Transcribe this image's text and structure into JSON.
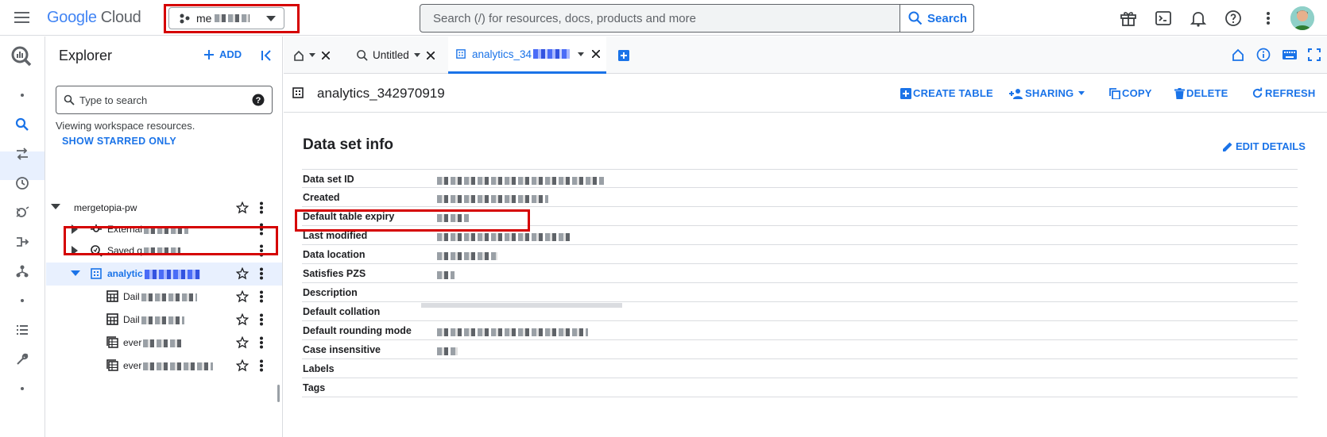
{
  "header": {
    "logo_google": "Google",
    "logo_cloud": "Cloud",
    "project_name": "me",
    "search_placeholder": "Search (/) for resources, docs, products and more",
    "search_button": "Search"
  },
  "explorer": {
    "title": "Explorer",
    "add_label": "ADD",
    "search_placeholder": "Type to search",
    "viewing_text": "Viewing workspace resources.",
    "starred_link": "SHOW STARRED ONLY",
    "tree": [
      {
        "label": "mergetopia-pw",
        "level": 0,
        "icon": "none"
      },
      {
        "label": "External",
        "level": 1,
        "icon": "connection-icon"
      },
      {
        "label": "Saved q",
        "level": 1,
        "icon": "saved-query-icon"
      },
      {
        "label": "analytic",
        "level": 1,
        "icon": "dataset-icon",
        "selected": true
      },
      {
        "label": "Dail",
        "level": 2,
        "icon": "table-icon"
      },
      {
        "label": "Dail",
        "level": 2,
        "icon": "table-icon"
      },
      {
        "label": "ever",
        "level": 2,
        "icon": "sharded-table-icon"
      },
      {
        "label": "ever",
        "level": 2,
        "icon": "sharded-table-icon"
      }
    ]
  },
  "tabs": {
    "items": [
      {
        "label": "",
        "icon": "home-icon"
      },
      {
        "label": "Untitled",
        "icon": "query-icon"
      },
      {
        "label": "analytics_34",
        "icon": "dataset-icon",
        "active": true
      }
    ]
  },
  "dataset": {
    "name": "analytics_342970919",
    "actions": {
      "create_table": "CREATE TABLE",
      "sharing": "SHARING",
      "copy": "COPY",
      "delete": "DELETE",
      "refresh": "REFRESH"
    },
    "info_title": "Data set info",
    "edit_details": "EDIT DETAILS",
    "rows": [
      {
        "key": "Data set ID"
      },
      {
        "key": "Created"
      },
      {
        "key": "Default table expiry"
      },
      {
        "key": "Last modified"
      },
      {
        "key": "Data location"
      },
      {
        "key": "Satisfies PZS"
      },
      {
        "key": "Description"
      },
      {
        "key": "Default collation"
      },
      {
        "key": "Default rounding mode"
      },
      {
        "key": "Case insensitive"
      },
      {
        "key": "Labels"
      },
      {
        "key": "Tags"
      }
    ]
  },
  "colors": {
    "accent": "#1a73e8",
    "highlight_border": "#d50000",
    "selected_bg": "#e8f0fe"
  }
}
